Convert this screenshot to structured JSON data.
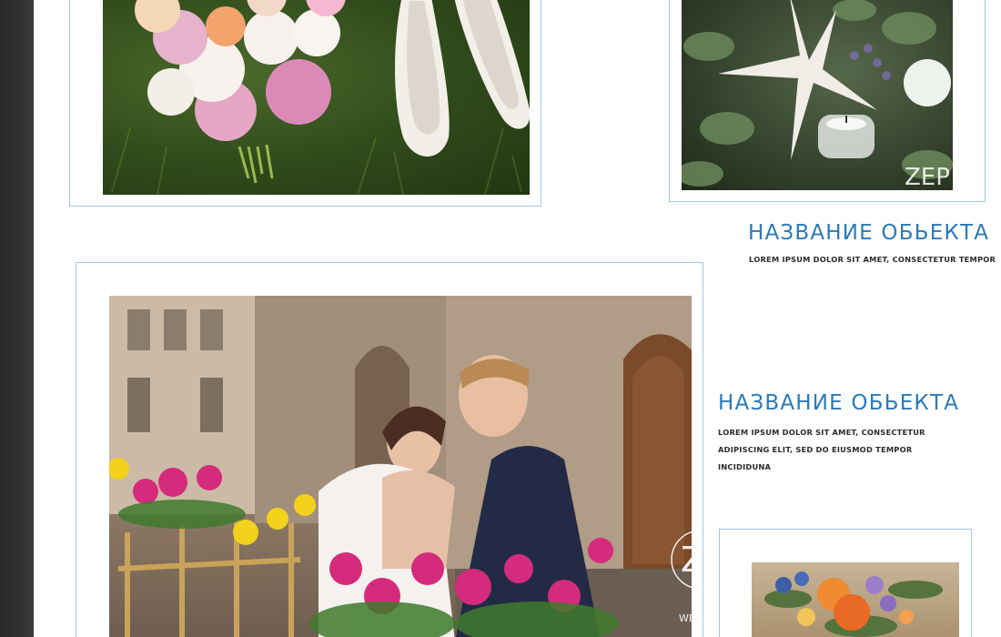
{
  "projects": [
    {
      "title": "",
      "description": []
    },
    {
      "title": "НАЗВАНИЕ ОБЬЕКТА",
      "description": [
        "LOREM IPSUM DOLOR SIT AMET, CONSECTETUR  TEMPOR"
      ]
    },
    {
      "title": "НАЗВАНИЕ ОБЬЕКТА",
      "description": [
        "LOREM IPSUM DOLOR SIT AMET, CONSECTETUR",
        "ADIPISCING ELIT, SED DO EIUSMOD TEMPOR",
        "INCIDIDUNA"
      ]
    }
  ],
  "colors": {
    "accent": "#2a7ab8",
    "card_border": "#9fcbe6",
    "side_strip": "#333333"
  }
}
